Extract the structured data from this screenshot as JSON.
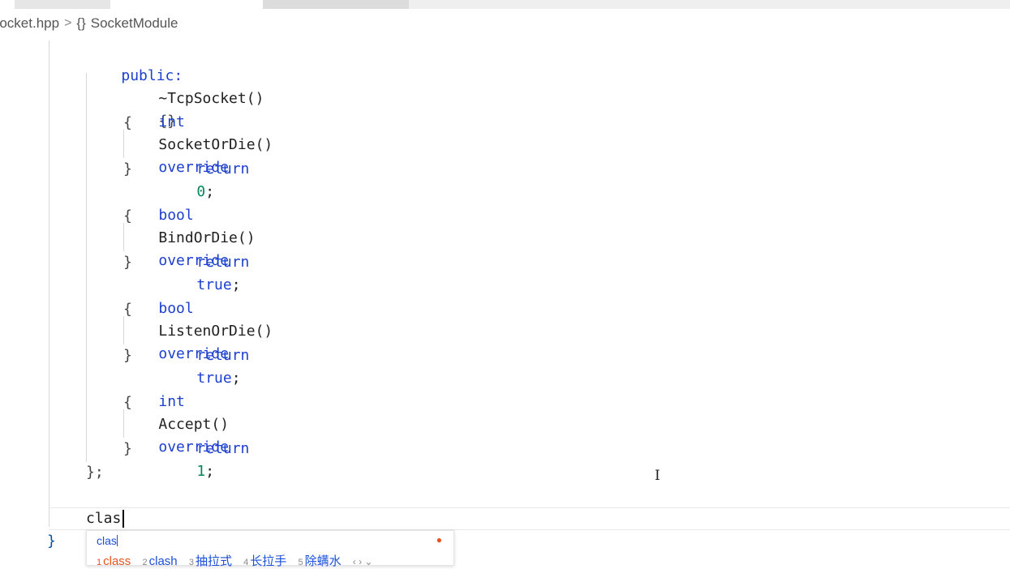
{
  "breadcrumb": {
    "file": "Socket.hpp",
    "separator": ">",
    "namespace_icon": "{}",
    "namespace": "SocketModule"
  },
  "code": {
    "public_kw": "public:",
    "destructor": "~TcpSocket()",
    "destructor_body": "{}",
    "int_kw": "int",
    "bool_kw": "bool",
    "override_kw": "override",
    "return_kw": "return",
    "true_kw": "true",
    "open_brace": "{",
    "close_brace": "}",
    "m1_name": "SocketOrDie()",
    "m1_ret": "0",
    "m2_name": "BindOrDie()",
    "m3_name": "ListenOrDie()",
    "m4_name": "Accept()",
    "m4_ret": "1",
    "semicolon": ";",
    "class_close": "};",
    "typing": "clas",
    "fold_brace": "}"
  },
  "ime": {
    "input": "clas",
    "logo_icon": "ime-brand-icon",
    "candidates": [
      {
        "index": "1",
        "text": "class"
      },
      {
        "index": "2",
        "text": "clash"
      },
      {
        "index": "3",
        "text": "抽拉式"
      },
      {
        "index": "4",
        "text": "长拉手"
      },
      {
        "index": "5",
        "text": "除螨水"
      }
    ],
    "nav": "‹ › ⌄"
  },
  "colors": {
    "keyword": "#0000ff",
    "number": "#098658",
    "ime_selected": "#e8541e",
    "ime_text": "#1a4fd6"
  }
}
